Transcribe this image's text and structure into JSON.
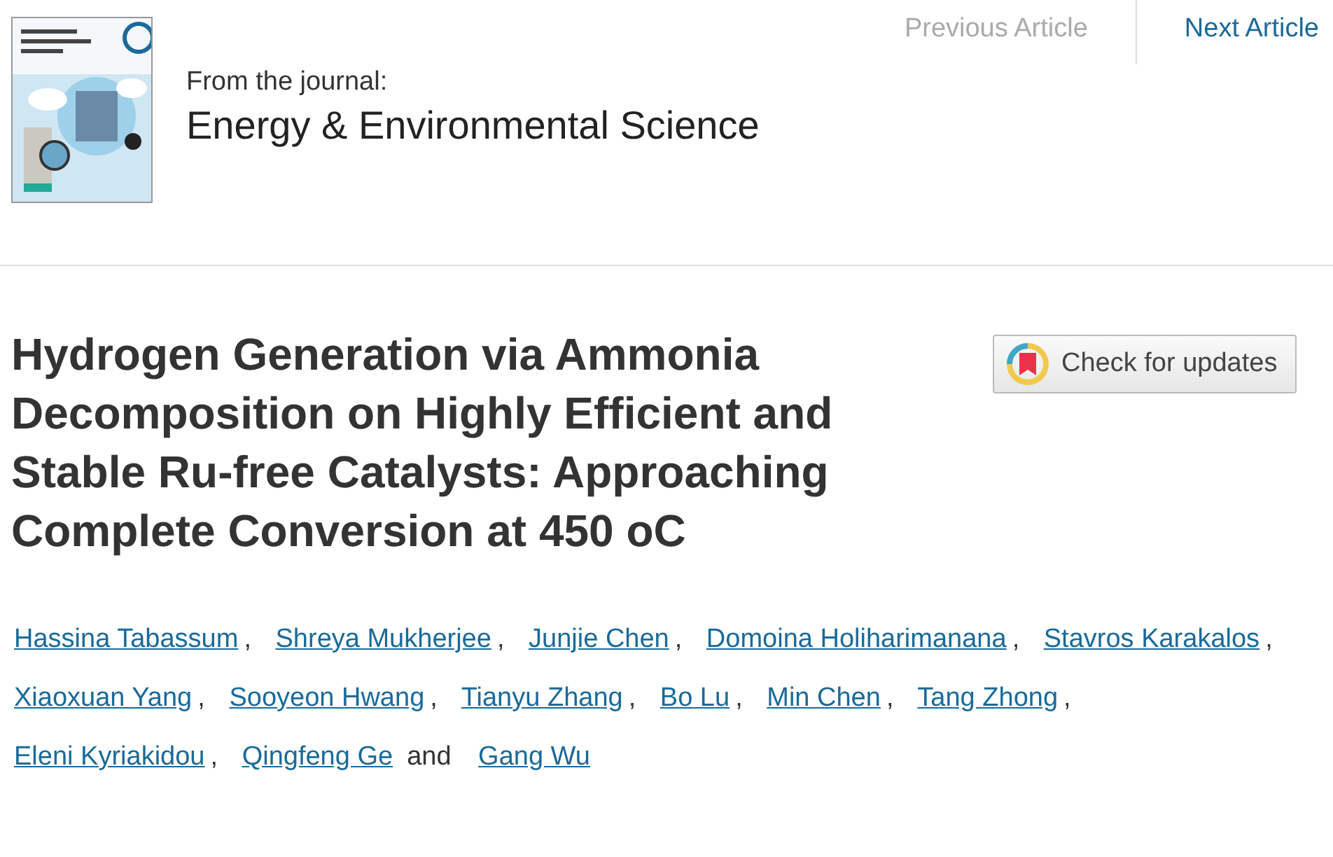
{
  "journal": {
    "kind": "picture",
    "label": "From the journal:",
    "name": "Energy & Environmental Science"
  },
  "nav": [
    {
      "label": "Previous Article",
      "disabled": true
    },
    {
      "label": "Next Article",
      "disabled": false
    }
  ],
  "article": {
    "title": "Hydrogen Generation via Ammonia Decomposition on Highly Efficient and Stable Ru-free Catalysts: Approaching Complete Conversion at 450 oC",
    "updates_button": "Check for updates"
  },
  "authors": [
    {
      "name": "Hassina Tabassum",
      "separator": ","
    },
    {
      "name": "Shreya Mukherjee",
      "separator": ","
    },
    {
      "name": "Junjie Chen",
      "separator": ","
    },
    {
      "name": "Domoina Holiharimanana",
      "separator": ","
    },
    {
      "name": "Stavros Karakalos",
      "separator": ","
    },
    {
      "name": "Xiaoxuan Yang",
      "separator": ","
    },
    {
      "name": "Sooyeon Hwang",
      "separator": ","
    },
    {
      "name": "Tianyu Zhang",
      "separator": ","
    },
    {
      "name": "Bo Lu",
      "separator": ","
    },
    {
      "name": "Min Chen",
      "separator": ","
    },
    {
      "name": "Tang Zhong",
      "separator": ","
    },
    {
      "name": "Eleni Kyriakidou",
      "separator": ","
    },
    {
      "name": "Qingfeng Ge",
      "separator": "and"
    },
    {
      "name": "Gang Wu"
    }
  ]
}
